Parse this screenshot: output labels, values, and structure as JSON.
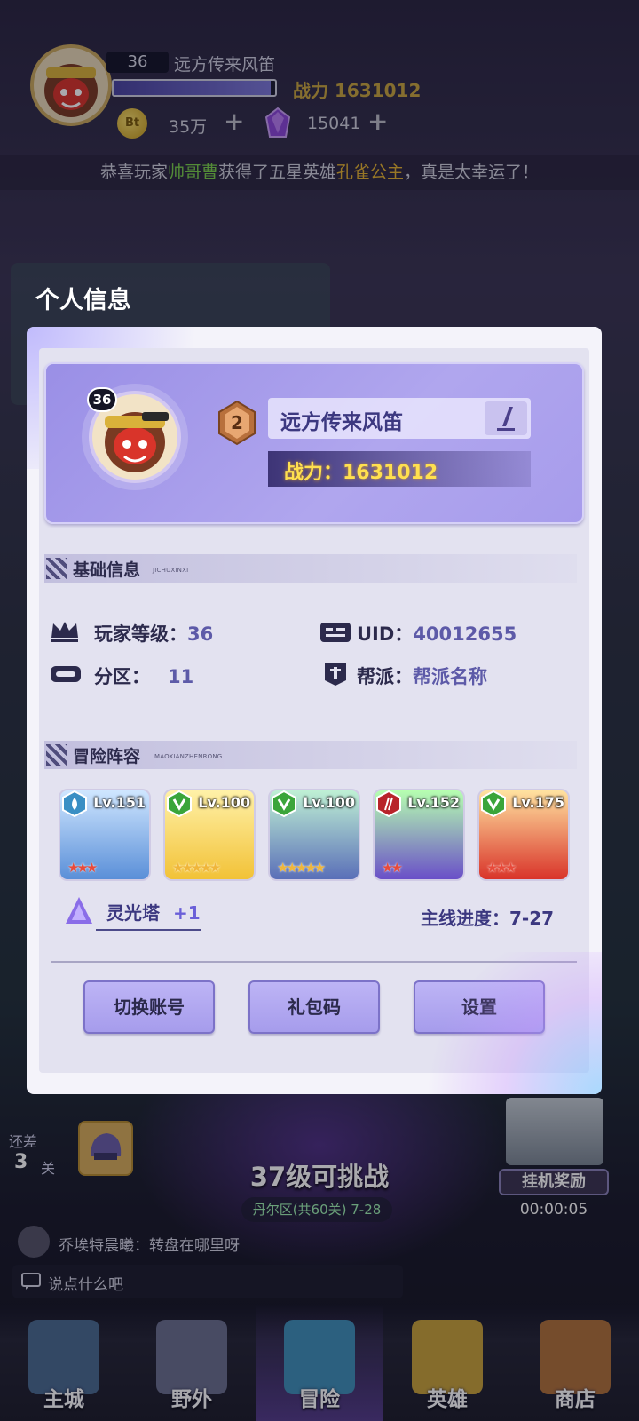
{
  "hud": {
    "level": "36",
    "name": "远方传来风笛",
    "exp_fraction": 0.97,
    "power_label": "战力",
    "power_value": "1631012",
    "coin_label": "Bt",
    "coins": "35万",
    "gems": "15041",
    "plus": "+"
  },
  "ticker": {
    "prefix": "恭喜玩家",
    "player": "帅哥曹",
    "middle": "获得了五星英雄",
    "hero": "孔雀公主",
    "suffix": "，真是太幸运了！"
  },
  "window_title": "个人信息",
  "profile": {
    "avatar_level": "36",
    "rank": "2",
    "name": "远方传来风笛",
    "power": "战力：1631012"
  },
  "basic": {
    "title": "基础信息",
    "subtitle": "JICHUXINXI",
    "player_level_label": "玩家等级：",
    "player_level": "36",
    "uid_label": "UID：",
    "uid": "40012655",
    "zone_label": "分区：",
    "zone": "11",
    "guild_label": "帮派：",
    "guild": "帮派名称"
  },
  "lineup": {
    "title": "冒险阵容",
    "subtitle": "MAOXIANZHENRONG",
    "heroes": [
      {
        "lv": "Lv.151",
        "stars": "★★★",
        "class_color": "#3a8fc4"
      },
      {
        "lv": "Lv.100",
        "stars": "★★★★★",
        "class_color": "#3aa53a"
      },
      {
        "lv": "Lv.100",
        "stars": "★★★★★",
        "class_color": "#3aa53a"
      },
      {
        "lv": "Lv.152",
        "stars": "★★",
        "class_color": "#b8242a"
      },
      {
        "lv": "Lv.175",
        "stars": "★★★",
        "class_color": "#3aa53a"
      }
    ],
    "tower_label": "灵光塔",
    "tower_value": "+1",
    "mainline": "主线进度：7-27"
  },
  "buttons": {
    "switch": "切换账号",
    "gift": "礼包码",
    "settings": "设置"
  },
  "stage": {
    "gap_label": "还差",
    "gap_num": "3",
    "gap_unit": "关",
    "challenge": "37级可挑战",
    "zone": "丹尔区(共60关) 7-28",
    "afk": "挂机奖励",
    "afk_time": "00:00:05"
  },
  "chat": {
    "message": "乔埃特晨曦：转盘在哪里呀",
    "placeholder": "说点什么吧"
  },
  "nav": [
    "主城",
    "野外",
    "冒险",
    "英雄",
    "商店"
  ],
  "colors": {
    "accent": "#a69cec",
    "power": "#ffe04f",
    "ticker_player": "#7bd14b",
    "ticker_hero": "#e5b330"
  }
}
